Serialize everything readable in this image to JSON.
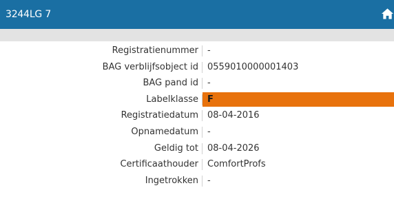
{
  "header": {
    "title": "3244LG 7",
    "home_icon": "home-icon"
  },
  "colors": {
    "header_bg": "#1a6fa3",
    "subbar_bg": "#e3e3e3",
    "label_class_F": "#e8720c"
  },
  "details": [
    {
      "label": "Registratienummer",
      "value": "-"
    },
    {
      "label": "BAG verblijfsobject id",
      "value": "0559010000001403"
    },
    {
      "label": "BAG pand id",
      "value": "-"
    },
    {
      "label": "Labelklasse",
      "value": "F"
    },
    {
      "label": "Registratiedatum",
      "value": "08-04-2016"
    },
    {
      "label": "Opnamedatum",
      "value": "-"
    },
    {
      "label": "Geldig tot",
      "value": "08-04-2026"
    },
    {
      "label": "Certificaathouder",
      "value": "ComfortProfs"
    },
    {
      "label": "Ingetrokken",
      "value": "-"
    }
  ]
}
